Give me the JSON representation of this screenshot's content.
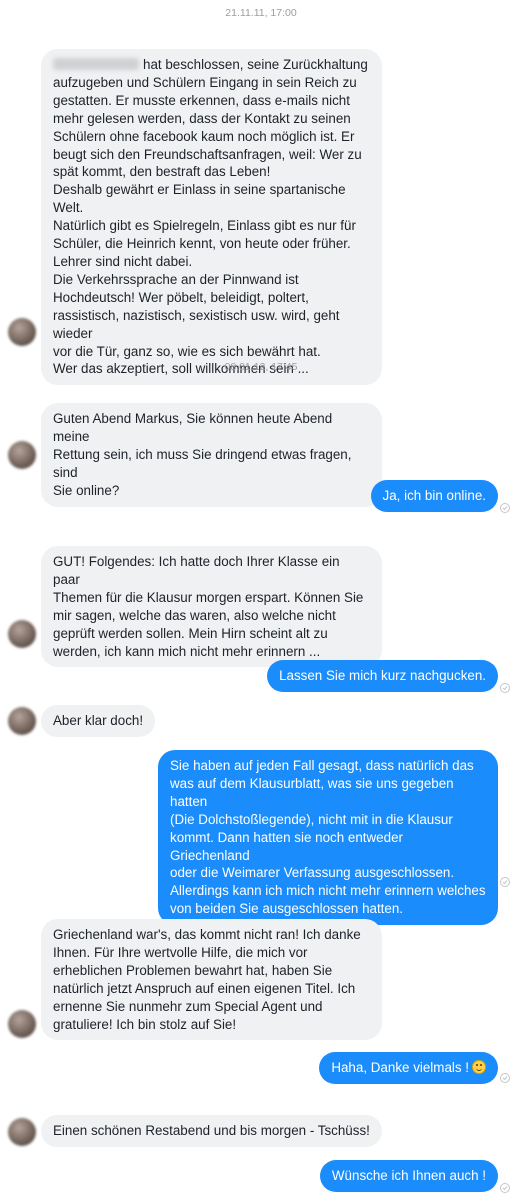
{
  "timestamps": [
    "21.11.11, 17:00",
    "08.01.12, 17:45"
  ],
  "messages": [
    {
      "side": "in",
      "text": "hat beschlossen, seine Zurückhaltung\naufzugeben und Schülern Eingang in sein Reich zu\ngestatten. Er musste erkennen, dass e-mails nicht\nmehr gelesen werden, dass der Kontakt zu seinen\nSchülern ohne facebook kaum noch möglich ist. Er\nbeugt sich den Freundschaftsanfragen, weil: Wer zu\nspät kommt, den bestraft das Leben!\nDeshalb gewährt er Einlass in seine spartanische Welt.\nNatürlich gibt es Spielregeln, Einlass gibt es nur für\nSchüler, die Heinrich kennt, von heute oder früher.\nLehrer sind nicht dabei.\nDie Verkehrssprache an der Pinnwand ist\nHochdeutsch! Wer pöbelt, beleidigt, poltert,\nrassistisch, nazistisch, sexistisch usw. wird, geht wieder\nvor die Tür, ganz so, wie es sich bewährt hat.\nWer das akzeptiert, soll willkommen sein ..."
    },
    {
      "side": "in",
      "text": "Guten Abend Markus, Sie können heute Abend meine\nRettung sein, ich muss Sie dringend etwas fragen, sind\nSie online?"
    },
    {
      "side": "out",
      "text": "Ja, ich bin online."
    },
    {
      "side": "in",
      "text": "GUT! Folgendes: Ich hatte doch Ihrer Klasse ein paar\nThemen für die Klausur morgen erspart. Können Sie\nmir sagen, welche das waren, also welche nicht\ngeprüft werden sollen. Mein Hirn scheint alt zu\nwerden, ich kann mich nicht mehr erinnern ..."
    },
    {
      "side": "out",
      "text": "Lassen Sie mich kurz nachgucken."
    },
    {
      "side": "in",
      "text": "Aber klar doch!"
    },
    {
      "side": "out",
      "text": "Sie haben auf jeden Fall gesagt, dass natürlich das\nwas auf dem Klausurblatt, was sie uns gegeben hatten\n(Die Dolchstoßlegende), nicht mit in die Klausur\nkommt. Dann hatten sie noch entweder Griechenland\noder die Weimarer Verfassung ausgeschlossen.\nAllerdings kann ich mich nicht mehr erinnern welches\nvon beiden Sie ausgeschlossen hatten."
    },
    {
      "side": "in",
      "text": "Griechenland war's, das kommt nicht ran! Ich danke\nIhnen. Für Ihre wertvolle Hilfe, die mich vor\nerheblichen Problemen bewahrt hat, haben Sie\nnatürlich jetzt Anspruch auf einen eigenen Titel. Ich\nernenne Sie nunmehr zum Special Agent und\ngratuliere! Ich bin stolz auf Sie!"
    },
    {
      "side": "out",
      "text": "Haha, Danke vielmals !",
      "emoji": "smiley-icon"
    },
    {
      "side": "in",
      "text": "Einen schönen Restabend und bis morgen - Tschüss!"
    },
    {
      "side": "out",
      "text": "Wünsche ich Ihnen auch !"
    }
  ]
}
